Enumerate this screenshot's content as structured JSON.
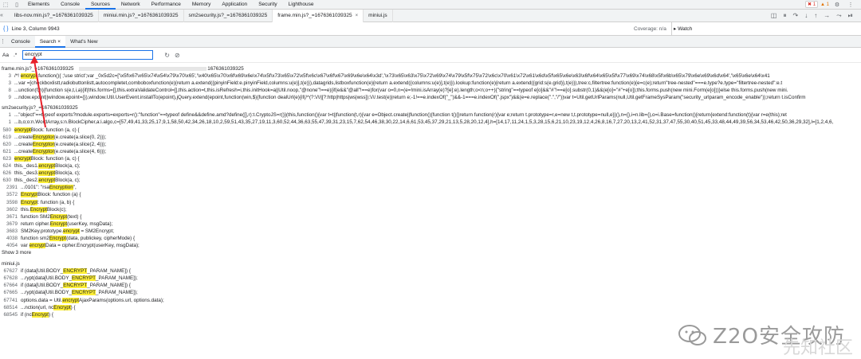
{
  "devtools": {
    "top_tabs": [
      "Elements",
      "Console",
      "Sources",
      "Network",
      "Performance",
      "Memory",
      "Application",
      "Security",
      "Lighthouse"
    ],
    "active_tab": "Sources",
    "errors": "1",
    "warnings": "1"
  },
  "file_tabs": [
    "libs-nov.min.js?_=1676361039325",
    "miniui.min.js?_=1676361039325",
    "sm2security.js?_=1676361039325",
    "frame.min.js?_=1676361039325",
    "miniui.js"
  ],
  "status": {
    "braces": "{ }",
    "position": "Line 3, Column 9943",
    "coverage": "Coverage: n/a",
    "watch": "▸ Watch"
  },
  "drawer_tabs": [
    "Console",
    "Search",
    "What's New"
  ],
  "search": {
    "case_opt": "Aa",
    "regex_opt": ".*",
    "query": "encrypt",
    "refresh_icon": "↻",
    "clear_icon": "⊘"
  },
  "results": {
    "group1": {
      "file": "frame.min.js?_=1676361039325",
      "suffix": "1676361039325",
      "lines": [
        {
          "ln": "3",
          "pre": "/*! ",
          "hit": "encrypt",
          "post": " function(){ ;'use strict';var _0x5d2c=['\\x5f\\x67\\x65\\x74\\x54\\x79\\x70\\x65','\\x40\\x65\\x70\\x6f\\x69\\x6e\\x74\\x5f\\x73\\x65\\x72\\x5f\\x6c\\x67\\x6f\\x67\\x69\\x6e\\x64\\x3d','\\x73\\x65\\x63\\x75\\x72\\x69\\x74\\x79\\x5f\\x75\\x72\\x6c\\x70\\x61\\x72\\x61\\x6d\\x5f\\x65\\x6e\\x63\\x6f\\x64\\x65\\x5f\\x77\\x69\\x74\\x68\\x5f\\x6b\\x65\\x79\\x6e\\x69\\x6d\\x64','\\x65\\x6e\\x64\\x41"
        },
        {
          "ln": "3",
          "pre": "...var =[checkboxlistt,radiobuttonlistt,autocompletet,comboboxfunction(e){return a.extend({pinyinField:e.pinyinField,columns:u(e)],t(e)}),datagrids,listboxfunction(e){return a.extend({columns:u(e)],t(e)}).lookup:function(e){return a.extend({grid:s(e.grid)},t(e)}),tree:c,filtertree:function(e){e=c(e);return\"tree-nested\"===e.type?e.type=\"filtertree-nested\":e.t",
          "hit": "",
          "post": ""
        },
        {
          "ln": "8",
          "pre": "...unction(f,h){function s(e,t,i,a){if(this.forms=[],this.extraValidateControl=[],this.action=t,this.isRefresh=i,this.initHook=a||Util.noop,\"@none\"!==e){if(e&&\"@all\"!==e)for(var o=0,n=(e=!mini.isArray(e)?[e]:e).length;o<n;o++){\"string\"==typeof e[o]&&\"#\"!==e[o].substr(0,1)&&(e[o]=\"#\"+e[o]);this.forms.push(new mini.Form(e[o]))}else this.forms.push(new mini.",
          "hit": "",
          "post": ""
        },
        {
          "ln": "9",
          "pre": "...ndow.epoint||window.epoint={}),window.Util.UserEvent.installTo(epoint),jQuery.extend(epoint,function(win,$){function dealUrl(e){if(/^(?:\\/\\/|[?:http|https|ws|wss]):\\/\\/.test(e)|return e;-1!==e.indexOf(\"_\")&&-1===e.indexOf(\".jspx\")&&(e=e.replace(\".\",\"/\"))var t=Util.getUrlParams(null,Util.getFrameSysParam(\"security_urlparam_encode_enable\"));return t.isConfirm",
          "hit": "",
          "post": ""
        }
      ]
    },
    "group2": {
      "file": "sm2security.js?_=1676361039325",
      "lines": [
        {
          "ln": "1",
          "pre": "...\"object\"==typeof exports?module.exports=exports=r():\"function\"==typeof define&&define.amd?define([],r):t.CryptoJS=r()}(this,function(){var t=t||function(t,r){var e=Object.create||function(){function t(){}return function(r){var e;return t.prototype=r,e=new t,t.prototype=null,e}}(),n={},i=n.lib={},o=i.Base=function(){return{extend:function(t){var r=e(this);ret",
          "hit": "",
          "post": ""
        },
        {
          "ln": "1",
          "pre": "...b,o;o:n.WordArray,s:n.BlockCipher,a:i.algo,c=[57,49,41,33,25,17,9,1,58,50,42,34,26,18,10,2,59,51,43,35,27,19,11,3,60,52,44,36,63,55,47,39,31,23,15,7,62,54,46,38,30,22,14,6,61,53,45,37,29,21,13,5,28,20,12,4],h=[14,17,11,24,1,5,3,28,15,6,21,10,23,19,12,4,26,8,16,7,27,20,13,2,41,52,31,37,47,55,30,40,51,45,33,48,44,49,39,56,34,53,46,42,50,36,29,32],l=[1,2,4,6,",
          "hit": "",
          "post": ""
        },
        {
          "ln": "580",
          "pre": "",
          "hit": "encrypt",
          "post": "Block: function (a, c) {"
        },
        {
          "ln": "619",
          "pre": "...create",
          "hit": "Encryptor",
          "post": "(e.create(a.slice(0, 2)));"
        },
        {
          "ln": "620",
          "pre": "...create",
          "hit": "Encryptor",
          "post": "(e.create(a.slice(2, 4)));"
        },
        {
          "ln": "621",
          "pre": "...create",
          "hit": "Encryptor",
          "post": "(e.create(a.slice(4, 6)));"
        },
        {
          "ln": "623",
          "pre": "",
          "hit": "encrypt",
          "post": "Block: function (a, c) {"
        },
        {
          "ln": "624",
          "pre": "this._des1.",
          "hit": "encrypt",
          "post": "Block(a, c);"
        },
        {
          "ln": "626",
          "pre": "this._des3.",
          "hit": "encrypt",
          "post": "Block(a, c);"
        },
        {
          "ln": "630",
          "pre": "this._des2.",
          "hit": "encrypt",
          "post": "Block(a, c);"
        },
        {
          "ln": "2391",
          "pre": "...0101\": \"rsa",
          "hit": "Encryption",
          "post": "\","
        },
        {
          "ln": "3572",
          "pre": "",
          "hit": "Encrypt",
          "post": "Block: function (a) {"
        },
        {
          "ln": "3598",
          "pre": "",
          "hit": "Encrypt",
          "post": ": function (a, b) {"
        },
        {
          "ln": "3602",
          "pre": "this.",
          "hit": "Encrypt",
          "post": "Block(c);"
        },
        {
          "ln": "3671",
          "pre": "function SM2",
          "hit": "Encrypt",
          "post": "(text) {"
        },
        {
          "ln": "3679",
          "pre": "return cipher.",
          "hit": "Encrypt",
          "post": "(userKey, msgData);"
        },
        {
          "ln": "3683",
          "pre": "SM2Key.prototype.",
          "hit": "encrypt",
          "post": " = SM2Encrypt;"
        },
        {
          "ln": "4038",
          "pre": "function sm2",
          "hit": "Encrypt",
          "post": "(data, publickey, cipherMode) {"
        },
        {
          "ln": "4054",
          "pre": "var ",
          "hit": "encrypt",
          "post": "Data = cipher.Encrypt(userKey, msgData);"
        }
      ],
      "show_more": "Show 3 more"
    },
    "group3": {
      "file": "miniui.js",
      "lines": [
        {
          "ln": "67627",
          "pre": "if (data[Util.BODY_",
          "hit": "ENCRYPT",
          "post": "_PARAM_NAME]) {"
        },
        {
          "ln": "67628",
          "pre": "...rypt(data[Util.BODY_",
          "hit": "ENCRYPT",
          "post": "_PARAM_NAME]);"
        },
        {
          "ln": "67664",
          "pre": "if (data[Util.BODY_",
          "hit": "ENCRYPT",
          "post": "_PARAM_NAME]) {"
        },
        {
          "ln": "67665",
          "pre": "...rypt(data[Util.BODY_",
          "hit": "ENCRYPT",
          "post": "_PARAM_NAME]);"
        },
        {
          "ln": "67741",
          "pre": "options.data = Util.",
          "hit": "encrypt",
          "post": "AjaxParams(options.url, options.data);"
        },
        {
          "ln": "68514",
          "pre": "...nction(url, nc",
          "hit": "Encrypt",
          "post": ") {"
        },
        {
          "ln": "68545",
          "pre": "if (nc",
          "hit": "Encrypt",
          "post": ") {"
        }
      ]
    }
  },
  "watermark": {
    "text": "Z2O安全攻防",
    "sub": "先知社区"
  },
  "colors": {
    "highlight": "#fdee36",
    "accent": "#1a73e8",
    "arrow": "#e8202a"
  }
}
